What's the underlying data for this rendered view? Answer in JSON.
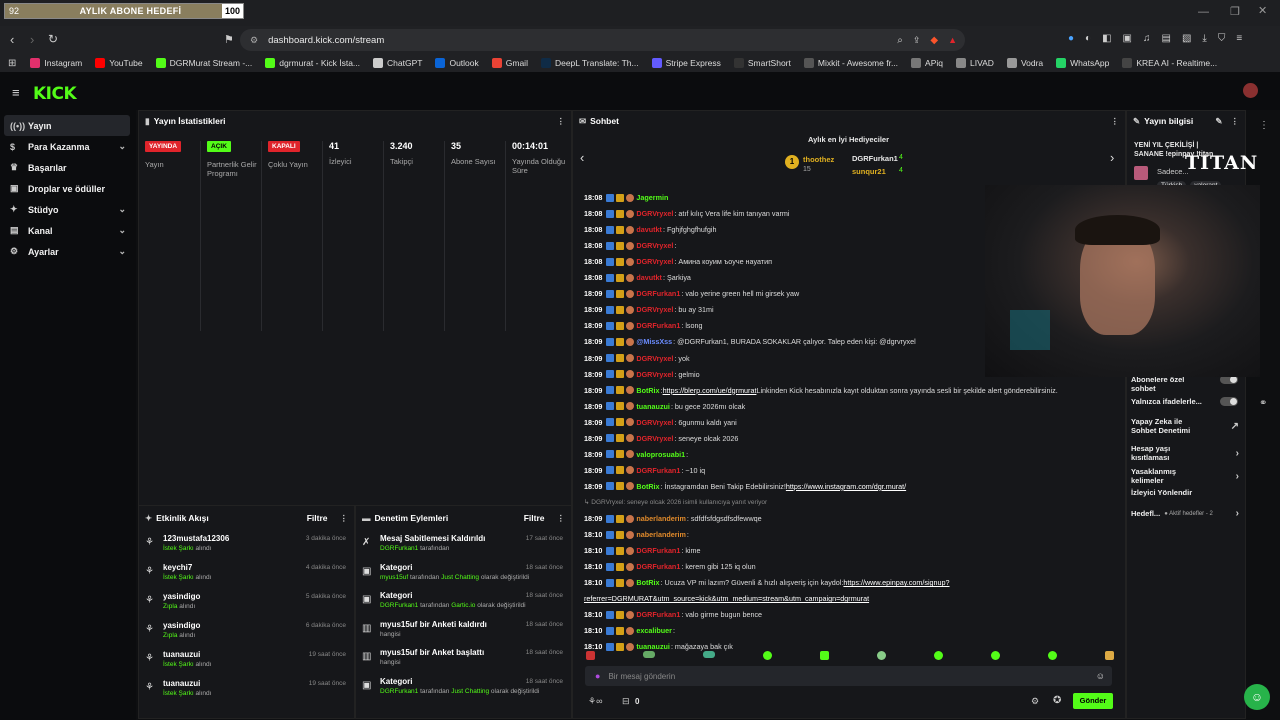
{
  "sub_goal": {
    "current": "92",
    "label": "AYLIK ABONE HEDEFİ",
    "target": "100",
    "progress": 0.92
  },
  "browser": {
    "url": "dashboard.kick.com/stream",
    "bookmarks": [
      {
        "label": "Instagram",
        "color": "#e1306c"
      },
      {
        "label": "YouTube",
        "color": "#ff0000"
      },
      {
        "label": "DGRMurat Stream -...",
        "color": "#53fc18"
      },
      {
        "label": "dgrmurat - Kick İsta...",
        "color": "#53fc18"
      },
      {
        "label": "ChatGPT",
        "color": "#cccccc"
      },
      {
        "label": "Outlook",
        "color": "#0a64d6"
      },
      {
        "label": "Gmail",
        "color": "#ea4335"
      },
      {
        "label": "DeepL Translate: Th...",
        "color": "#0f2b46"
      },
      {
        "label": "Stripe Express",
        "color": "#635bff"
      },
      {
        "label": "SmartShort",
        "color": "#333333"
      },
      {
        "label": "Mixkit - Awesome fr...",
        "color": "#555555"
      },
      {
        "label": "APiq",
        "color": "#777777"
      },
      {
        "label": "LIVAD",
        "color": "#888888"
      },
      {
        "label": "Vodra",
        "color": "#999999"
      },
      {
        "label": "WhatsApp",
        "color": "#25d366"
      },
      {
        "label": "KREA AI - Realtime...",
        "color": "#444444"
      }
    ]
  },
  "kick": {
    "logo": "KICK"
  },
  "sidebar": {
    "items": [
      {
        "label": "Yayın",
        "icon": "broadcast-icon",
        "chevron": false,
        "active": true
      },
      {
        "label": "Para Kazanma",
        "icon": "money-icon",
        "chevron": true
      },
      {
        "label": "Başarılar",
        "icon": "trophy-icon",
        "chevron": false
      },
      {
        "label": "Droplar ve ödüller",
        "icon": "gift-icon",
        "chevron": false
      },
      {
        "label": "Stüdyo",
        "icon": "studio-icon",
        "chevron": true
      },
      {
        "label": "Kanal",
        "icon": "channel-icon",
        "chevron": true
      },
      {
        "label": "Ayarlar",
        "icon": "gear-icon",
        "chevron": true
      }
    ]
  },
  "stats": {
    "title": "Yayın İstatistikleri",
    "cols": [
      {
        "badge": "YAYINDA",
        "badge_color": "#e0242b",
        "label": "Yayın"
      },
      {
        "badge": "AÇIK",
        "badge_color": "#53fc18",
        "label": "Partnerlik Gelir Programı"
      },
      {
        "badge": "KAPALI",
        "badge_color": "#e0242b",
        "label": "Çoklu Yayın"
      },
      {
        "value": "41",
        "label": "İzleyici"
      },
      {
        "value": "3.240",
        "label": "Takipçi"
      },
      {
        "value": "35",
        "label": "Abone Sayısı"
      },
      {
        "value": "00:14:01",
        "label": "Yayında Olduğu Süre"
      }
    ]
  },
  "activity": {
    "title": "Etkinlik Akışı",
    "filter": "Filtre",
    "items": [
      {
        "name": "123mustafa12306",
        "sub": "İstek Şarkı",
        "rest": " alındı",
        "time": "3 dakika önce"
      },
      {
        "name": "keychi7",
        "sub": "İstek Şarkı",
        "rest": " alındı",
        "time": "4 dakika önce"
      },
      {
        "name": "yasindigo",
        "sub": "Zıpla",
        "rest": " alındı",
        "time": "5 dakika önce"
      },
      {
        "name": "yasindigo",
        "sub": "Zıpla",
        "rest": " alındı",
        "time": "6 dakika önce"
      },
      {
        "name": "tuanauzui",
        "sub": "İstek Şarkı",
        "rest": " alındı",
        "time": "19 saat önce"
      },
      {
        "name": "tuanauzui",
        "sub": "İstek Şarkı",
        "rest": " alındı",
        "time": "19 saat önce"
      }
    ]
  },
  "moderation": {
    "title": "Denetim Eylemleri",
    "filter": "Filtre",
    "items": [
      {
        "title": "Mesaj Sabitlemesi Kaldırıldı",
        "who": "DGRFurkan1",
        "rest": " tarafından",
        "extra": "",
        "extra2": "",
        "time": "17 saat önce",
        "icon": "unpin-icon"
      },
      {
        "title": "Kategori",
        "who": "myus15uf",
        "rest": " tarafından ",
        "extra": "Just Chatting",
        "extra2": " olarak değiştirildi",
        "time": "18 saat önce",
        "icon": "category-icon"
      },
      {
        "title": "Kategori",
        "who": "DGRFurkan1",
        "rest": " tarafından ",
        "extra": "Gartic.io",
        "extra2": " olarak değiştirildi",
        "time": "18 saat önce",
        "icon": "category-icon"
      },
      {
        "title": "myus15uf bir Anketi kaldırdı",
        "who": "",
        "rest": "hangisi",
        "extra": "",
        "extra2": "",
        "time": "18 saat önce",
        "icon": "poll-icon"
      },
      {
        "title": "myus15uf bir Anket başlattı",
        "who": "",
        "rest": "hangisi",
        "extra": "",
        "extra2": "",
        "time": "18 saat önce",
        "icon": "poll-icon"
      },
      {
        "title": "Kategori",
        "who": "DGRFurkan1",
        "rest": " tarafından ",
        "extra": "Just Chatting",
        "extra2": " olarak değiştirildi",
        "time": "18 saat önce",
        "icon": "category-icon"
      }
    ]
  },
  "chat": {
    "title": "Sohbet",
    "gifters_title": "Aylık en İyi Hediyeciler",
    "gifters": [
      {
        "rank": "1",
        "name": "thoothez",
        "count": "15"
      },
      {
        "name": "DGRFurkan1",
        "count": "4"
      },
      {
        "name": "sunqur21",
        "count": "4"
      }
    ],
    "messages": [
      {
        "time": "18:08",
        "user": "Jagermin",
        "color": "#53fc18",
        "text": ""
      },
      {
        "time": "18:08",
        "user": "DGRVryxel",
        "color": "#e0242b",
        "text": ": atıf kılıç Vera life kim tanıyan varmi"
      },
      {
        "time": "18:08",
        "user": "davutkt",
        "color": "#e0242b",
        "text": ": Fghjfghgfhufgih"
      },
      {
        "time": "18:08",
        "user": "DGRVryxel",
        "color": "#e0242b",
        "text": ":"
      },
      {
        "time": "18:08",
        "user": "DGRVryxel",
        "color": "#e0242b",
        "text": ": Амина коуим ъоуче науатип"
      },
      {
        "time": "18:08",
        "user": "davutkt",
        "color": "#e0242b",
        "text": ": Şarkiya"
      },
      {
        "time": "18:09",
        "user": "DGRFurkan1",
        "color": "#e0242b",
        "text": ": valo yerine green hell mi girsek yaw"
      },
      {
        "time": "18:09",
        "user": "DGRVryxel",
        "color": "#e0242b",
        "text": ": bu ay 31mi"
      },
      {
        "time": "18:09",
        "user": "DGRFurkan1",
        "color": "#e0242b",
        "text": ": lsong"
      },
      {
        "time": "18:09",
        "user": "@MissXss",
        "color": "#6b8cff",
        "text": ": @DGRFurkan1, BURADA SOKAKLAR çalıyor.     Talep eden kişi: @dgrvryxel"
      },
      {
        "time": "18:09",
        "user": "DGRVryxel",
        "color": "#e0242b",
        "text": ": yok"
      },
      {
        "time": "18:09",
        "user": "DGRVryxel",
        "color": "#e0242b",
        "text": ": gelmio"
      },
      {
        "time": "18:09",
        "user": "BotRix",
        "color": "#53fc18",
        "text": ": ",
        "link": "https://blerp.com/ue/dgrmurat",
        "after": " Linkinden Kick hesabınızla kayıt olduktan sonra yayında sesli bir şekilde alert gönderebilirsiniz."
      },
      {
        "time": "18:09",
        "user": "tuanauzui",
        "color": "#53fc18",
        "text": ": bu gece 2026mı olcak"
      },
      {
        "time": "18:09",
        "user": "DGRVryxel",
        "color": "#e0242b",
        "text": ": 6gunmu kaldı yani"
      },
      {
        "time": "18:09",
        "user": "DGRVryxel",
        "color": "#e0242b",
        "text": ": seneye olcak 2026"
      },
      {
        "time": "18:09",
        "user": "valoprosuabi1",
        "color": "#53fc18",
        "text": ":"
      },
      {
        "time": "18:09",
        "user": "DGRFurkan1",
        "color": "#e0242b",
        "text": ": ~10 iq"
      },
      {
        "time": "18:09",
        "user": "BotRix",
        "color": "#53fc18",
        "text": ": İnstagramdan Beni Takip Edebilirsiniz! ",
        "link": "https://www.instagram.com/dgr.murat/",
        "after": ""
      },
      {
        "time": "",
        "user": "",
        "color": "#888888",
        "text": "↳ DGRVryxel: seneye olcak 2026 isimli kullanıcıya yanıt veriyor",
        "reply": true
      },
      {
        "time": "18:09",
        "user": "naberlanderim",
        "color": "#e08a2b",
        "text": ": sdfdfsfdgsdfsdfewwqe"
      },
      {
        "time": "18:10",
        "user": "naberlanderim",
        "color": "#e08a2b",
        "text": ":"
      },
      {
        "time": "18:10",
        "user": "DGRFurkan1",
        "color": "#e0242b",
        "text": ": kime"
      },
      {
        "time": "18:10",
        "user": "DGRFurkan1",
        "color": "#e0242b",
        "text": ": kerem gibi 125 iq olun"
      },
      {
        "time": "18:10",
        "user": "BotRix",
        "color": "#53fc18",
        "text": ":    Ucuza VP mi lazım?   Güvenli & hızlı alışveriş için kaydol: ",
        "link": "https://www.epinpay.com/signup?",
        "after": ""
      },
      {
        "time": "",
        "user": "",
        "color": "#dddddd",
        "text": "",
        "link": "referrer=DGRMURAT&utm_source=kick&utm_medium=stream&utm_campaign=dgrmurat",
        "cont": true
      },
      {
        "time": "18:10",
        "user": "DGRFurkan1",
        "color": "#e0242b",
        "text": ": valo girme bugun bence"
      },
      {
        "time": "18:10",
        "user": "excalibuer",
        "color": "#53fc18",
        "text": ":"
      },
      {
        "time": "18:10",
        "user": "tuanauzui",
        "color": "#53fc18",
        "text": ": mağazaya bak çık"
      }
    ],
    "input_placeholder": "Bir mesaj gönderin",
    "count": "0",
    "send_label": "Gönder"
  },
  "stream_info": {
    "title": "Yayın bilgisi",
    "stream_title": "YENİ YIL ÇEKİLİŞİ | SANANE !epinpay !titan",
    "subtitle": "Sadece...",
    "tags": [
      "Türkish",
      "valorant"
    ],
    "titan": "TITAN",
    "settings": [
      {
        "label": "Abonelere özel sohbet",
        "toggle": true
      },
      {
        "label": "Yalnızca ifadelerle...",
        "toggle": true
      },
      {
        "label": "Yapay Zeka ile Sohbet Denetimi",
        "toggle": false,
        "arrow": "↗"
      },
      {
        "label": "Hesap yaşı kısıtlaması",
        "toggle": false,
        "arrow": "›"
      },
      {
        "label": "Yasaklanmış kelimeler",
        "toggle": false,
        "arrow": "›"
      },
      {
        "label": "İzleyici Yönlendir",
        "toggle": false,
        "arrow": ""
      },
      {
        "label": "Hedefl...",
        "toggle": false,
        "arrow": "›",
        "status": "● Aktif hedefler - 2"
      }
    ]
  },
  "colors": {
    "accent": "#53fc18",
    "live": "#e0242b",
    "bg": "#0e0f11",
    "panel": "#16171a"
  }
}
